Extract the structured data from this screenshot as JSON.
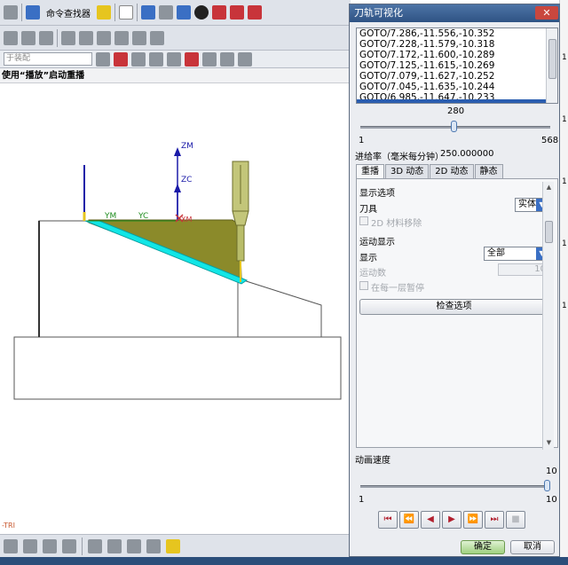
{
  "toolbar": {
    "command_finder_label": "命令查找器",
    "filter_placeholder": "于装配"
  },
  "status_bar": {
    "prompt": "使用“播放”启动重播"
  },
  "graphics": {
    "axis_zm": "ZM",
    "axis_zc": "ZC",
    "axis_ym": "YM",
    "axis_yc": "YC",
    "axis_xm": "XM",
    "triad_label": "-TRI"
  },
  "dialog": {
    "title": "刀轨可视化",
    "gotos": [
      "GOTO/7.286,-11.556,-10.352",
      "GOTO/7.228,-11.579,-10.318",
      "GOTO/7.172,-11.600,-10.289",
      "GOTO/7.125,-11.615,-10.269",
      "GOTO/7.079,-11.627,-10.252",
      "GOTO/7.045,-11.635,-10.244",
      "GOTO/6.985,-11.647,-10.233"
    ],
    "position_slider": {
      "value": "280",
      "min": "1",
      "max": "568",
      "value_fraction": 0.493
    },
    "feedrate_label": "进给率（毫米每分钟）",
    "feedrate_value": "250.000000",
    "tabs": [
      "重播",
      "3D 动态",
      "2D 动态",
      "静态"
    ],
    "display_options_header": "显示选项",
    "tool_label": "刀具",
    "tool_value": "实体",
    "material_removal_2d_label": "2D 材料移除",
    "motion_display_header": "运动显示",
    "display_label": "显示",
    "display_value": "全部",
    "motion_count_label": "运动数",
    "motion_count_value": "10",
    "pause_each_layer_label": "在每一层暂停",
    "check_options_button": "检查选项",
    "animation_speed_label": "动画速度",
    "speed_slider": {
      "value": "10",
      "min": "1",
      "max": "10",
      "value_fraction": 1.0
    },
    "ok_button": "确定",
    "cancel_button": "取消"
  },
  "colors": {
    "title_bar": "#2f5384",
    "part_stock": "#8b8a2a",
    "cut_face": "#12e6e6",
    "tool": "#b9bd6a",
    "axis_blue": "#1a1aa8"
  }
}
